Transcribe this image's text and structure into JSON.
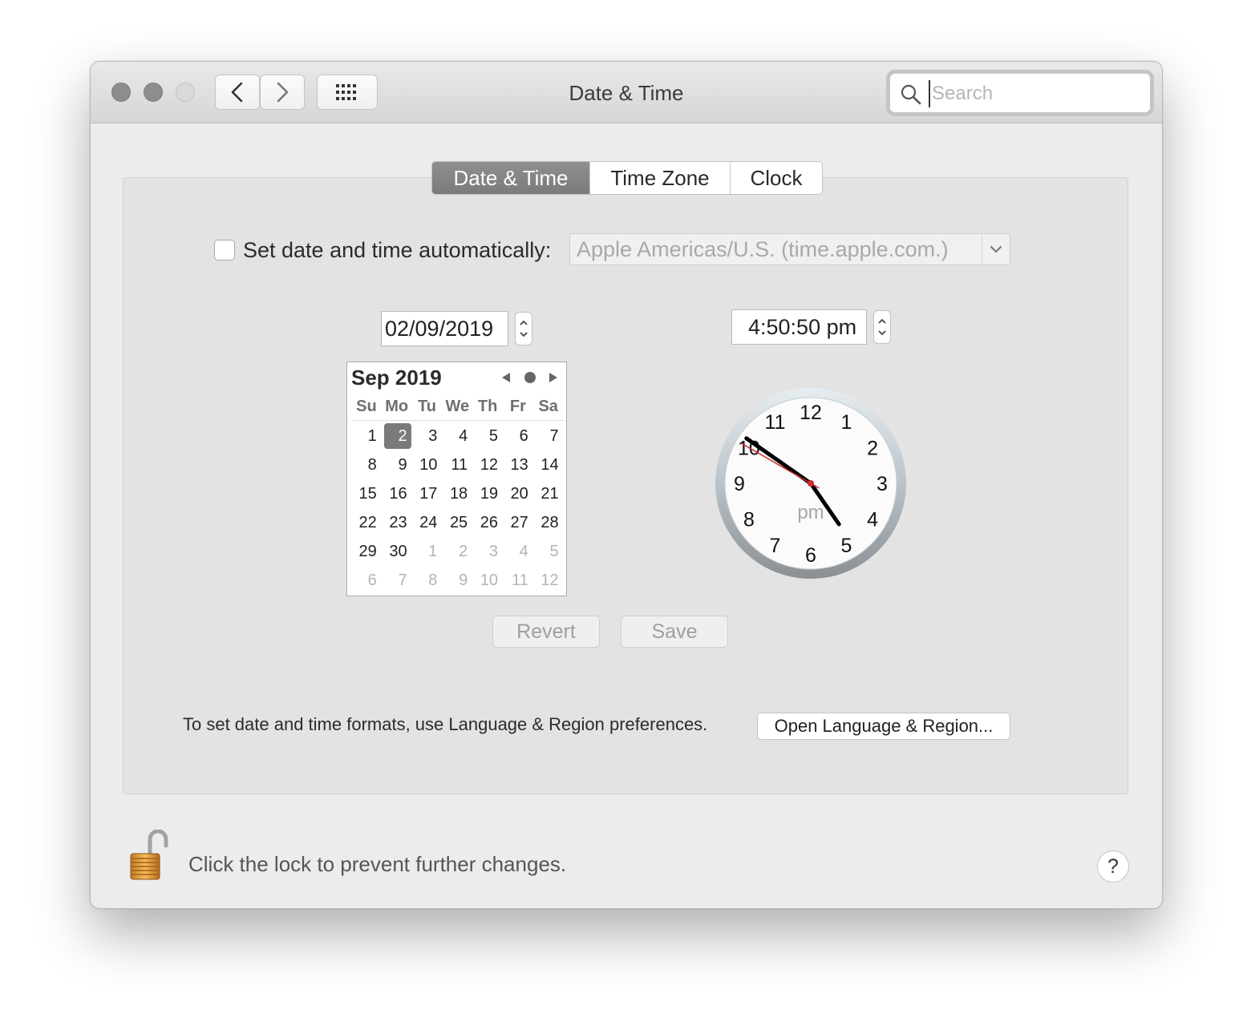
{
  "window": {
    "title": "Date & Time"
  },
  "toolbar": {
    "back_icon": "chevron-left-icon",
    "forward_icon": "chevron-right-icon",
    "grid_icon": "show-all-grid-icon"
  },
  "search": {
    "placeholder": "Search",
    "value": ""
  },
  "tabs": [
    {
      "label": "Date & Time",
      "active": true
    },
    {
      "label": "Time Zone",
      "active": false
    },
    {
      "label": "Clock",
      "active": false
    }
  ],
  "auto": {
    "label": "Set date and time automatically:",
    "checked": false,
    "server": "Apple Americas/U.S. (time.apple.com.)"
  },
  "date_field": {
    "value": "02/09/2019"
  },
  "time_field": {
    "value": "4:50:50 pm"
  },
  "calendar": {
    "month_label": "Sep 2019",
    "weekdays": [
      "Su",
      "Mo",
      "Tu",
      "We",
      "Th",
      "Fr",
      "Sa"
    ],
    "selected_day": "2",
    "weeks": [
      [
        {
          "d": "1"
        },
        {
          "d": "2"
        },
        {
          "d": "3"
        },
        {
          "d": "4"
        },
        {
          "d": "5"
        },
        {
          "d": "6"
        },
        {
          "d": "7"
        }
      ],
      [
        {
          "d": "8"
        },
        {
          "d": "9"
        },
        {
          "d": "10"
        },
        {
          "d": "11"
        },
        {
          "d": "12"
        },
        {
          "d": "13"
        },
        {
          "d": "14"
        }
      ],
      [
        {
          "d": "15"
        },
        {
          "d": "16"
        },
        {
          "d": "17"
        },
        {
          "d": "18"
        },
        {
          "d": "19"
        },
        {
          "d": "20"
        },
        {
          "d": "21"
        }
      ],
      [
        {
          "d": "22"
        },
        {
          "d": "23"
        },
        {
          "d": "24"
        },
        {
          "d": "25"
        },
        {
          "d": "26"
        },
        {
          "d": "27"
        },
        {
          "d": "28"
        }
      ],
      [
        {
          "d": "29"
        },
        {
          "d": "30"
        },
        {
          "d": "1",
          "other": true
        },
        {
          "d": "2",
          "other": true
        },
        {
          "d": "3",
          "other": true
        },
        {
          "d": "4",
          "other": true
        },
        {
          "d": "5",
          "other": true
        }
      ],
      [
        {
          "d": "6",
          "other": true
        },
        {
          "d": "7",
          "other": true
        },
        {
          "d": "8",
          "other": true
        },
        {
          "d": "9",
          "other": true
        },
        {
          "d": "10",
          "other": true
        },
        {
          "d": "11",
          "other": true
        },
        {
          "d": "12",
          "other": true
        }
      ]
    ]
  },
  "clock": {
    "numbers": [
      "12",
      "1",
      "2",
      "3",
      "4",
      "5",
      "6",
      "7",
      "8",
      "9",
      "10",
      "11"
    ],
    "meridiem": "pm",
    "hour": 4,
    "minute": 50,
    "second": 50,
    "hand_color": "#000000",
    "second_hand_color": "#d0282c"
  },
  "buttons": {
    "revert": "Revert",
    "save": "Save",
    "open_language": "Open Language & Region..."
  },
  "formats_note": "To set date and time formats, use Language & Region preferences.",
  "lock": {
    "text": "Click the lock to prevent further changes.",
    "icon": "unlocked-padlock-icon"
  },
  "help": {
    "label": "?"
  }
}
